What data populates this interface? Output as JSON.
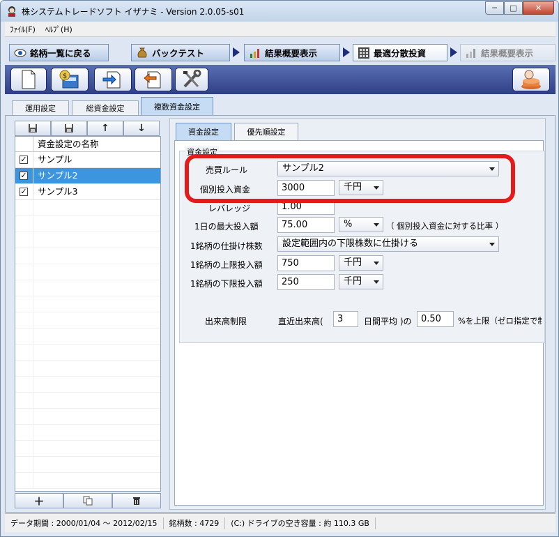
{
  "window": {
    "title": "株システムトレードソフト イザナミ - Version 2.0.05-s01",
    "buttons": {
      "minimize": "─",
      "maximize": "□",
      "close": "✕"
    }
  },
  "menu": {
    "items": [
      "ﾌｧｲﾙ(F)",
      "ﾍﾙﾌﾟ(H)"
    ]
  },
  "nav": {
    "back_label": "銘柄一覧に戻る",
    "backtest_label": "バックテスト",
    "summary1_label": "結果概要表示",
    "optimal_label": "最適分散投資",
    "summary2_label": "結果概要表示"
  },
  "toolbar": {
    "icons": [
      "new-file-icon",
      "money-calculator-icon",
      "import-icon",
      "export-icon",
      "tools-icon",
      "run-icon"
    ]
  },
  "settings_tabs": {
    "tab1": "運用設定",
    "tab2": "総資金設定",
    "tab3": "複数資金設定"
  },
  "left": {
    "header": "資金設定の名称",
    "items": [
      {
        "label": "サンプル",
        "checked": true
      },
      {
        "label": "サンプル2",
        "checked": true
      },
      {
        "label": "サンプル3",
        "checked": true
      }
    ]
  },
  "right": {
    "tab_capital": "資金設定",
    "tab_priority": "優先順設定",
    "group_title": "資金設定",
    "fields": {
      "trade_rule_label": "売買ルール",
      "trade_rule_value": "サンプル2",
      "individual_label": "個別投入資金",
      "individual_value": "3000",
      "individual_unit": "千円",
      "leverage_label": "レバレッジ",
      "leverage_value": "1.00",
      "max_daily_label": "1日の最大投入額",
      "max_daily_value": "75.00",
      "max_daily_unit": "%",
      "max_daily_note": "（ 個別投入資金に対する比率 ）",
      "order_shares_label": "1銘柄の仕掛け株数",
      "order_shares_value": "設定範囲内の下限株数に仕掛ける",
      "upper_label": "1銘柄の上限投入額",
      "upper_value": "750",
      "upper_unit": "千円",
      "lower_label": "1銘柄の下限投入額",
      "lower_value": "250",
      "lower_unit": "千円",
      "volume_label": "出来高制限",
      "volume_prefix": "直近出来高(",
      "volume_days": "3",
      "volume_mid": "日間平均 )の",
      "volume_ratio": "0.50",
      "volume_suffix": "%を上限（ゼロ指定で制"
    }
  },
  "status": {
    "data_period": "データ期間 : 2000/01/04 〜 2012/02/15",
    "stock_count": "銘柄数 : 4729",
    "disk_space": "(C:) ドライブの空き容量 : 約 110.3 GB"
  }
}
